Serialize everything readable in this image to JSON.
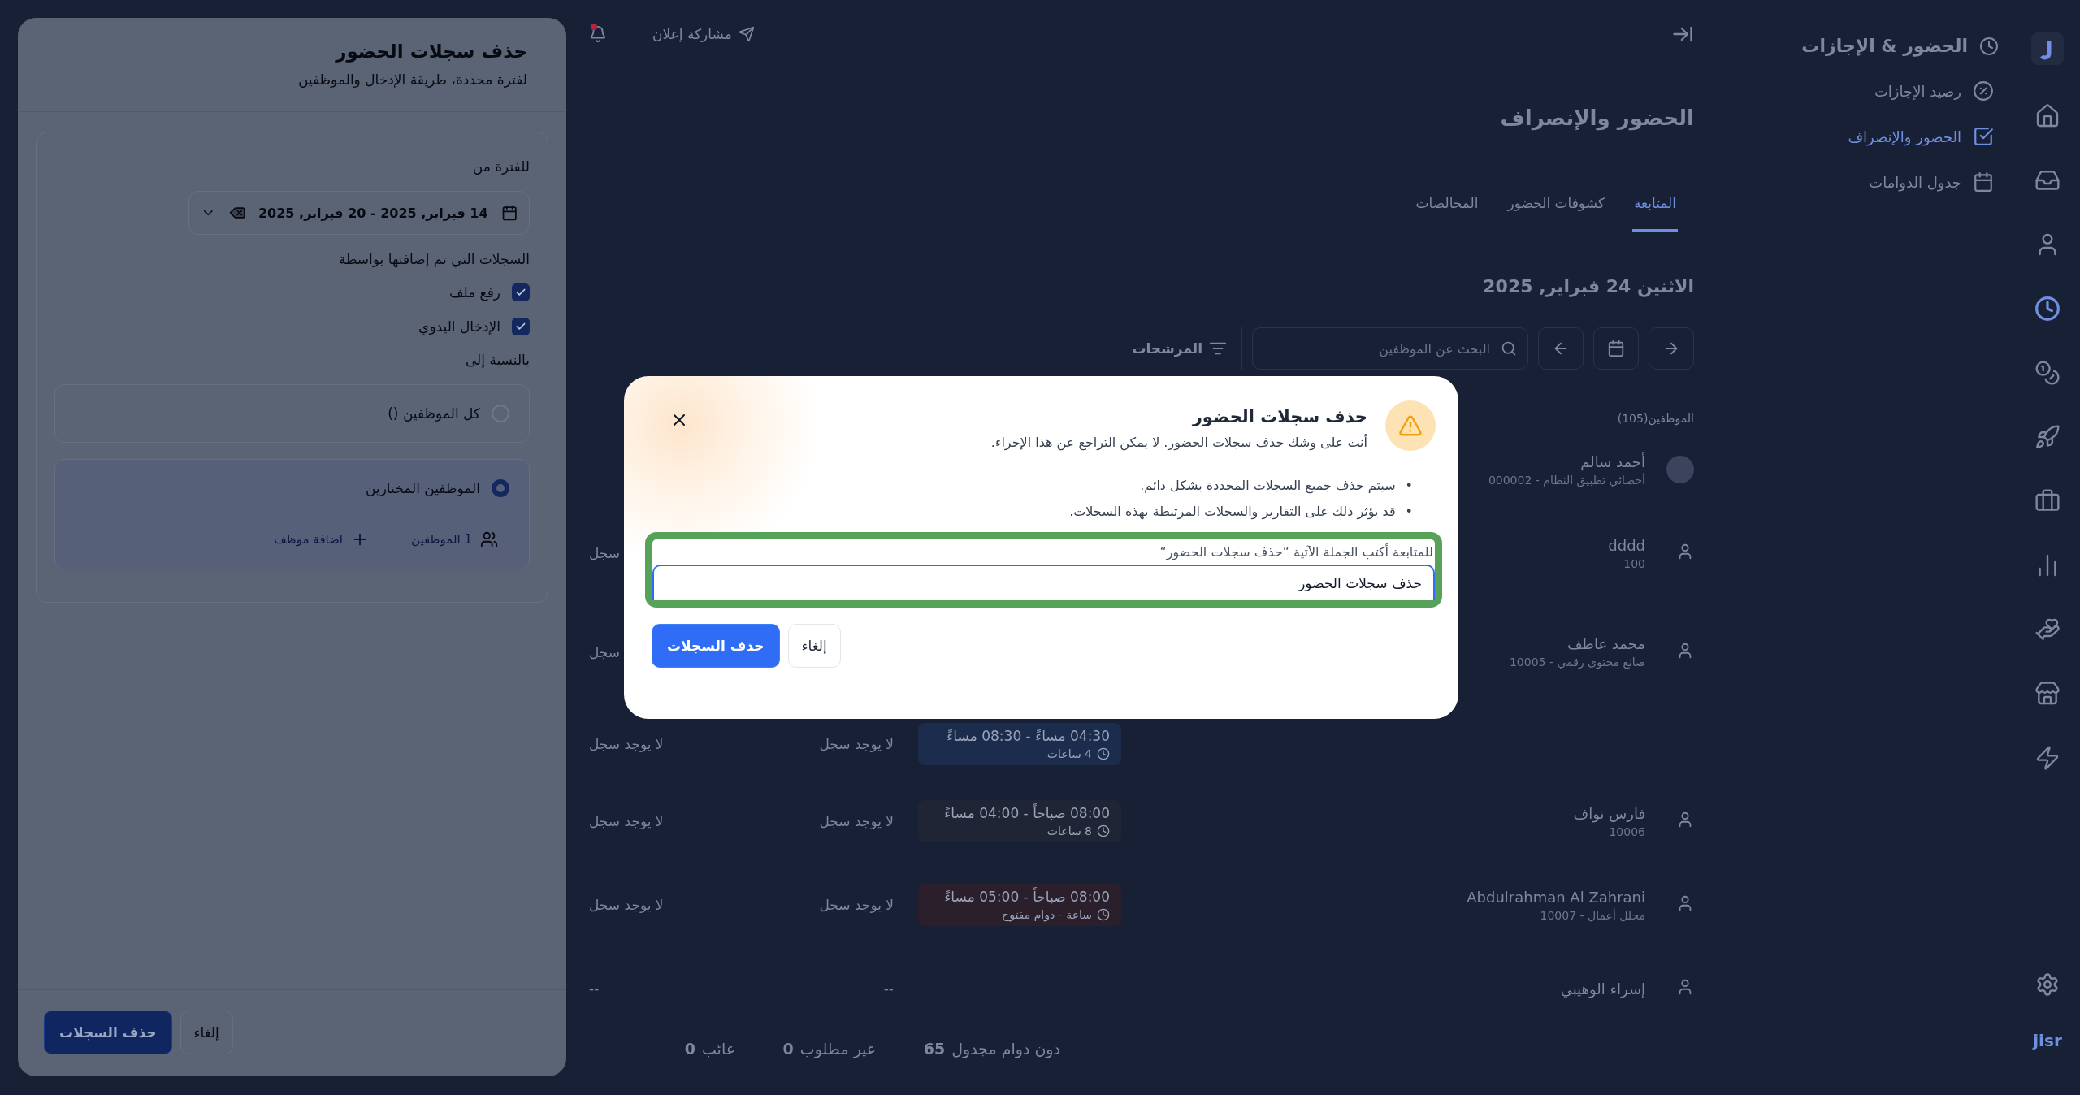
{
  "rail": {
    "items": [
      {
        "selected": false
      },
      {
        "selected": false
      },
      {
        "selected": false
      },
      {
        "selected": true
      },
      {
        "selected": false
      },
      {
        "selected": false
      },
      {
        "selected": false
      },
      {
        "selected": false
      },
      {
        "selected": false
      },
      {
        "selected": false
      },
      {
        "selected": false
      }
    ],
    "brand": "jisr"
  },
  "sidebar": {
    "title": "الحضور & الإجازات",
    "items": [
      {
        "label": "رصيد الإجازات",
        "selected": false
      },
      {
        "label": "الحضور والإنصراف",
        "selected": true
      },
      {
        "label": "جدول الدوامات",
        "selected": false
      }
    ]
  },
  "topbar": {
    "announce": "مشاركة إعلان",
    "notification_dot": true
  },
  "page": {
    "title": "الحضور والإنصراف",
    "tabs": [
      {
        "label": "المتابعة",
        "selected": true
      },
      {
        "label": "كشوفات الحضور",
        "selected": false
      },
      {
        "label": "المخالصات",
        "selected": false
      }
    ],
    "date": "الاثنين 24 فبراير, 2025",
    "search_placeholder": "البحث عن الموظفين",
    "filter": "المرشحات",
    "employees_count": "الموظفين(105)"
  },
  "rows": [
    {
      "name": "أحمد سالم",
      "subtitle": "أخصائي تطبيق النظام - 000002",
      "has_photo": true
    },
    {
      "name": "dddd",
      "subtitle": "100",
      "has_photo": false,
      "column_1": "سجل"
    },
    {
      "name": "محمد عاطف",
      "subtitle": "صانع محتوى رقمي - 10005",
      "has_photo": false,
      "column_1": "سجل"
    },
    {
      "shift": {
        "time": "04:30 مساءً - 08:30 مساءً",
        "duration": "4 ساعات",
        "color": "#1c2c4c"
      },
      "column_2": "لا يوجد سجل",
      "column_1": "لا يوجد سجل"
    },
    {
      "name": "فارس نواف",
      "subtitle": "10006",
      "has_photo": false,
      "shift": {
        "time": "08:00 صباحاً - 04:00 مساءً",
        "duration": "8 ساعات",
        "color": "#1f2534"
      },
      "column_2": "لا يوجد سجل",
      "column_1": "لا يوجد سجل"
    },
    {
      "name": "Abdulrahman Al Zahrani",
      "subtitle": "محلل أعمال - 10007",
      "has_photo": false,
      "shift": {
        "time": "08:00 صباحاً - 05:00 مساءً",
        "duration": "ساعة - دوام مفتوح",
        "color": "#2c1f2c"
      },
      "column_2": "لا يوجد سجل",
      "column_1": "لا يوجد سجل"
    },
    {
      "name": "إسراء الوهيبي",
      "has_photo": false,
      "column_2": "--",
      "column_1": "--"
    }
  ],
  "summary": [
    {
      "value": "65",
      "label": "دون دوام مجدول"
    },
    {
      "value": "0",
      "label": "غير مطلوب"
    },
    {
      "value": "0",
      "label": "غائب"
    }
  ],
  "drawer": {
    "title": "حذف سجلات الحضور",
    "subtitle": "لفترة محددة، طريقة الإدخال والموظفين",
    "period_label": "للفترة من",
    "period_value": "14 فبراير, 2025 - 20 فبراير, 2025",
    "added_by_label": "السجلات التي تم إضافتها بواسطة",
    "sources": [
      {
        "label": "رفع ملف",
        "checked": true
      },
      {
        "label": "الإدخال اليدوي",
        "checked": true
      }
    ],
    "scope_label": "بالنسبة إلى",
    "scopes": [
      {
        "label": "كل الموظفين ()",
        "selected": false
      },
      {
        "label": "الموظفين المختارين",
        "selected": true,
        "count": "1 الموظفين",
        "add": "اضافة موظف"
      }
    ],
    "confirm": "حذف السجلات",
    "cancel": "إلغاء"
  },
  "modal": {
    "title": "حذف سجلات الحضور",
    "subtitle": "أنت على وشك حذف سجلات الحضور. لا يمكن التراجع عن هذا الإجراء.",
    "marker": "•",
    "bullets": [
      "سيتم حذف جميع السجلات المحددة بشكل دائم.",
      "قد يؤثر ذلك على التقارير والسجلات المرتبطة بهذه السجلات."
    ],
    "prompt": "للمتابعة أكتب الجملة الآتية “حذف سجلات الحضور“",
    "value": "حذف سجلات الحضور",
    "highlighted": true,
    "confirm": "حذف السجلات",
    "cancel": "إلغاء"
  }
}
